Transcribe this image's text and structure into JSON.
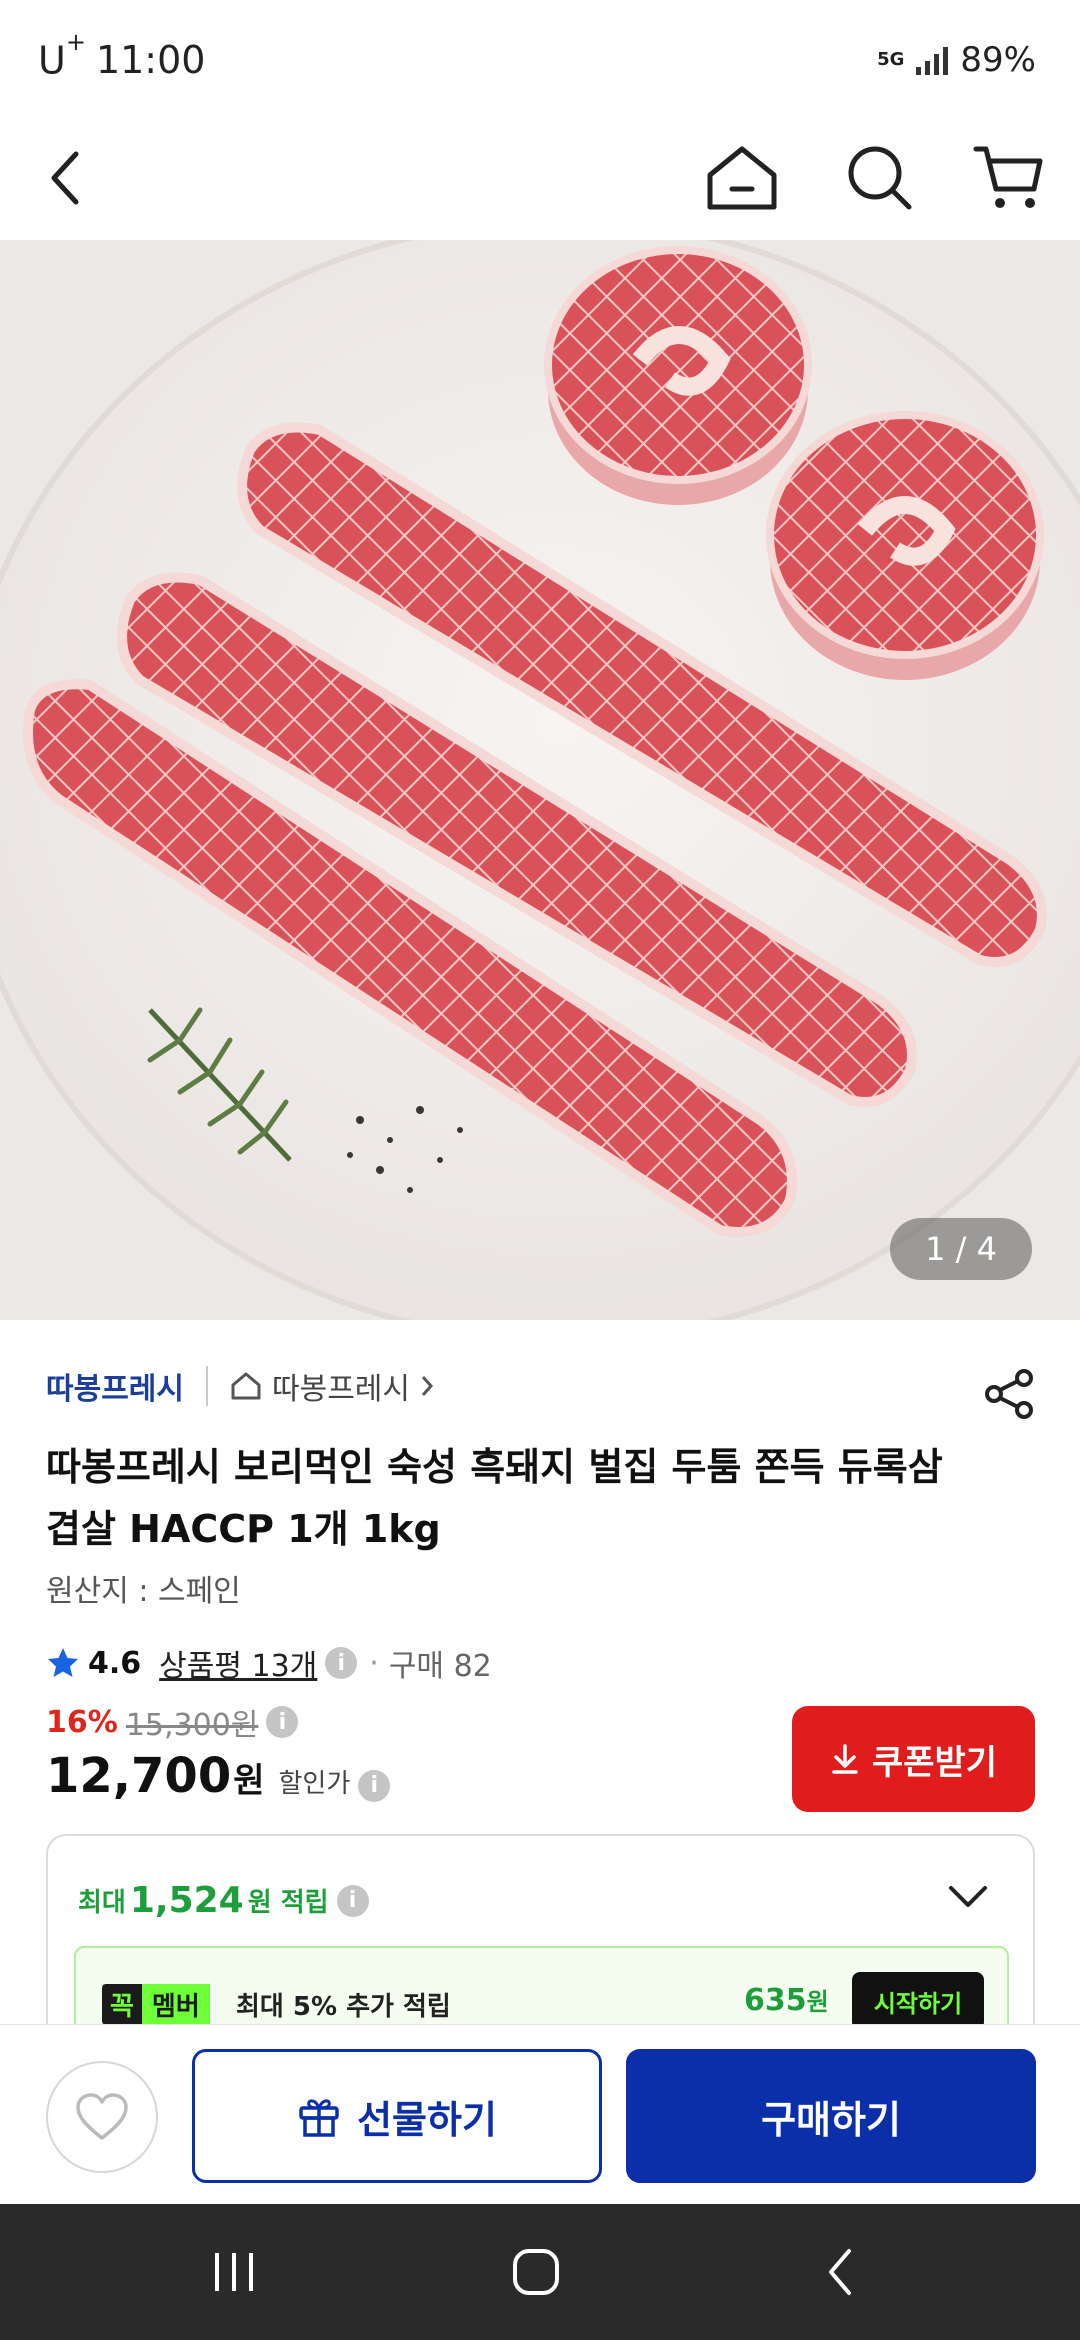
{
  "status_bar": {
    "carrier": "U",
    "carrier_sup": "+",
    "time": "11:00",
    "network": "5G",
    "battery": "89%"
  },
  "app_bar": {
    "icons": [
      "back-arrow-icon",
      "home-icon",
      "search-icon",
      "cart-icon"
    ]
  },
  "hero": {
    "counter": "1 / 4"
  },
  "product": {
    "brand": "따봉프레시",
    "store_link": "따봉프레시",
    "title": "따봉프레시 보리먹인 숙성 흑돼지 벌집 두툼 쫀득 듀록삼겹살 HACCP 1개 1kg",
    "origin": "원산지 : 스페인",
    "rating": "4.6",
    "review_label": "상품평 13개",
    "purchase_label": "구매 82"
  },
  "price": {
    "discount_rate": "16%",
    "original_price": "15,300원",
    "sale_price": "12,700",
    "currency": "원",
    "price_label": "할인가",
    "coupon_button": "쿠폰받기"
  },
  "reward": {
    "prefix": "최대",
    "amount": "1,524",
    "suffix": "원 적립",
    "member_badge_k": "꼭",
    "member_badge_m": "멤버",
    "member_text": "최대 5% 추가 적립",
    "member_amount": "635",
    "member_currency": "원",
    "start_button": "시작하기"
  },
  "actions": {
    "gift_button": "선물하기",
    "buy_button": "구매하기"
  },
  "colors": {
    "brand_blue": "#0b2fa8",
    "coupon_red": "#e11c1c",
    "reward_green": "#1d9e3b",
    "member_green": "#6fff38"
  }
}
